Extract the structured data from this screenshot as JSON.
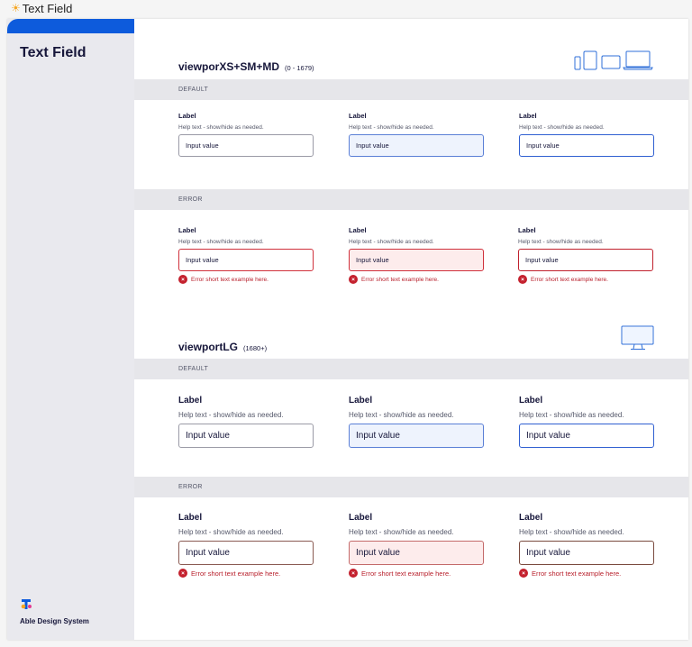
{
  "page": {
    "title": "Text Field"
  },
  "sidebar": {
    "title": "Text Field",
    "brand": "Able Design System"
  },
  "sections": {
    "small": {
      "title": "viewporXS+SM+MD",
      "range": "(0 - 1679)"
    },
    "large": {
      "title": "viewportLG",
      "range": "(1680+)"
    }
  },
  "bands": {
    "default": "DEFAULT",
    "error": "ERROR"
  },
  "field": {
    "label": "Label",
    "help": "Help text - show/hide as needed.",
    "value": "Input value",
    "error": "Error short text example here."
  },
  "colors": {
    "accent": "#0d5bdc",
    "error": "#c4212e",
    "focus": "#2f5fd1"
  },
  "icons": {
    "sun": "sun-icon",
    "error": "error-circle-icon",
    "devices": "devices-icon",
    "desktop": "desktop-icon",
    "logo": "telstra-logo-icon"
  }
}
